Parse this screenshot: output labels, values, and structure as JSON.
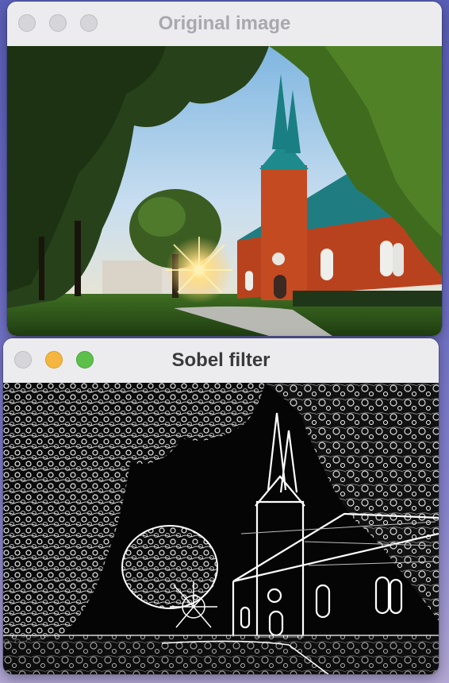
{
  "windows": [
    {
      "id": "original",
      "title": "Original image",
      "state": "inactive",
      "buttons": [
        "close-icon",
        "minimize-icon",
        "zoom-icon"
      ]
    },
    {
      "id": "sobel",
      "title": "Sobel filter",
      "state": "active",
      "buttons": [
        "close-icon",
        "minimize-icon",
        "zoom-icon"
      ]
    }
  ],
  "colors": {
    "desktop": "#5a5fb8",
    "titlebar": "#ececef",
    "title_inactive": "#a9a9ad",
    "title_active": "#3a3a3c",
    "button_inactive": "#d6d6da",
    "button_minimize": "#f5b63f",
    "button_zoom": "#5cc04a"
  },
  "images": {
    "original": "photo of red brick church with twin teal spires, trees and sunburst",
    "sobel": "black and white edge-detected version of the church photo"
  }
}
